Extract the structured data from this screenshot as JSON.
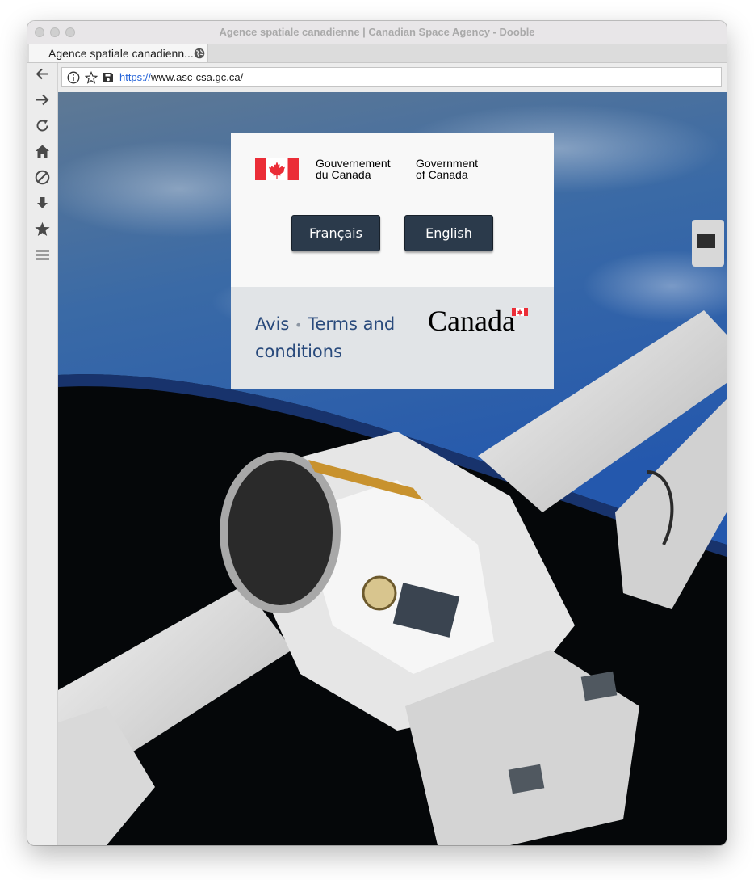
{
  "window": {
    "title": "Agence spatiale canadienne | Canadian Space Agency - Dooble"
  },
  "tabs": [
    {
      "label": "Agence spatiale canadienn...",
      "icon": "globe-icon"
    }
  ],
  "sidebar": {
    "items": [
      {
        "name": "back",
        "icon": "arrow-left-icon"
      },
      {
        "name": "forward",
        "icon": "arrow-right-icon"
      },
      {
        "name": "reload",
        "icon": "reload-icon"
      },
      {
        "name": "home",
        "icon": "home-icon"
      },
      {
        "name": "stop",
        "icon": "stop-icon"
      },
      {
        "name": "downloads",
        "icon": "download-icon"
      },
      {
        "name": "favorites",
        "icon": "star-icon"
      },
      {
        "name": "menu",
        "icon": "hamburger-menu-icon"
      }
    ]
  },
  "urlbar": {
    "scheme": "https://",
    "rest": "www.asc-csa.gc.ca/",
    "icons": [
      "info-icon",
      "bookmark-star-icon",
      "save-icon"
    ]
  },
  "splash": {
    "signature": {
      "fr_line1": "Gouvernement",
      "fr_line2": "du Canada",
      "en_line1": "Government",
      "en_line2": "of Canada"
    },
    "buttons": {
      "francais": "Français",
      "english": "English"
    },
    "footer": {
      "avis": "Avis",
      "separator": "•",
      "terms": "Terms and conditions",
      "wordmark": "Canada"
    }
  },
  "colors": {
    "button_bg": "#2b3a4b",
    "link": "#294a7c",
    "flag_red": "#eb2d37",
    "url_scheme": "#2463d8"
  }
}
